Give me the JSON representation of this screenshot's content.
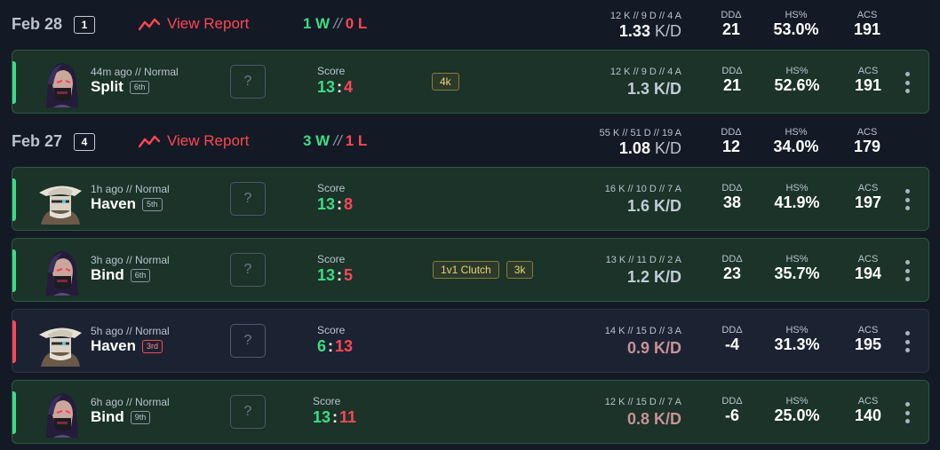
{
  "days": [
    {
      "date": "Feb 28",
      "count": "1",
      "report_label": "View Report",
      "wins": "1 W",
      "losses": "0 L",
      "kda": "12 K // 9 D // 4 A",
      "kd": "1.33",
      "kd_unit": "K/D",
      "dd_label": "DDΔ",
      "dd": "21",
      "hs_label": "HS%",
      "hs": "53.0%",
      "acs_label": "ACS",
      "acs": "191"
    },
    {
      "date": "Feb 27",
      "count": "4",
      "report_label": "View Report",
      "wins": "3 W",
      "losses": "1 L",
      "kda": "55 K // 51 D // 19 A",
      "kd": "1.08",
      "kd_unit": "K/D",
      "dd_label": "DDΔ",
      "dd": "12",
      "hs_label": "HS%",
      "hs": "34.0%",
      "acs_label": "ACS",
      "acs": "179"
    }
  ],
  "matches": [
    {
      "result": "win",
      "agent": "reyna",
      "meta": "44m ago // Normal",
      "map": "Split",
      "place": "6th",
      "unknown": "?",
      "score_label": "Score",
      "score_a": "13",
      "score_b": "4",
      "badges": [
        "4k"
      ],
      "kda": "12 K // 9 D // 4 A",
      "kd": "1.3 K/D",
      "dd_label": "DDΔ",
      "dd": "21",
      "hs_label": "HS%",
      "hs": "52.6%",
      "acs_label": "ACS",
      "acs": "191"
    },
    {
      "result": "win",
      "agent": "cypher",
      "meta": "1h ago // Normal",
      "map": "Haven",
      "place": "5th",
      "unknown": "?",
      "score_label": "Score",
      "score_a": "13",
      "score_b": "8",
      "badges": [],
      "kda": "16 K // 10 D // 7 A",
      "kd": "1.6 K/D",
      "dd_label": "DDΔ",
      "dd": "38",
      "hs_label": "HS%",
      "hs": "41.9%",
      "acs_label": "ACS",
      "acs": "197"
    },
    {
      "result": "win",
      "agent": "reyna",
      "meta": "3h ago // Normal",
      "map": "Bind",
      "place": "6th",
      "unknown": "?",
      "score_label": "Score",
      "score_a": "13",
      "score_b": "5",
      "badges": [
        "1v1 Clutch",
        "3k"
      ],
      "kda": "13 K // 11 D // 2 A",
      "kd": "1.2 K/D",
      "dd_label": "DDΔ",
      "dd": "23",
      "hs_label": "HS%",
      "hs": "35.7%",
      "acs_label": "ACS",
      "acs": "194"
    },
    {
      "result": "loss",
      "agent": "cypher",
      "meta": "5h ago // Normal",
      "map": "Haven",
      "place": "3rd",
      "unknown": "?",
      "score_label": "Score",
      "score_a": "6",
      "score_b": "13",
      "badges": [],
      "kda": "14 K // 15 D // 3 A",
      "kd": "0.9 K/D",
      "dd_label": "DDΔ",
      "dd": "-4",
      "hs_label": "HS%",
      "hs": "31.3%",
      "acs_label": "ACS",
      "acs": "195"
    },
    {
      "result": "win",
      "agent": "reyna",
      "meta": "6h ago // Normal",
      "map": "Bind",
      "place": "9th",
      "unknown": "?",
      "score_label": "Score",
      "score_a": "13",
      "score_b": "11",
      "badges": [],
      "kda": "12 K // 15 D // 7 A",
      "kd": "0.8 K/D",
      "dd_label": "DDΔ",
      "dd": "-6",
      "hs_label": "HS%",
      "hs": "25.0%",
      "acs_label": "ACS",
      "acs": "140"
    }
  ],
  "colors": {
    "background": "#131a25",
    "win_card": "#1b3328",
    "loss_card": "#1b2332",
    "win_green": "#3ddc84",
    "loss_red": "#ff4655",
    "badge_gold": "#e8d27a"
  }
}
